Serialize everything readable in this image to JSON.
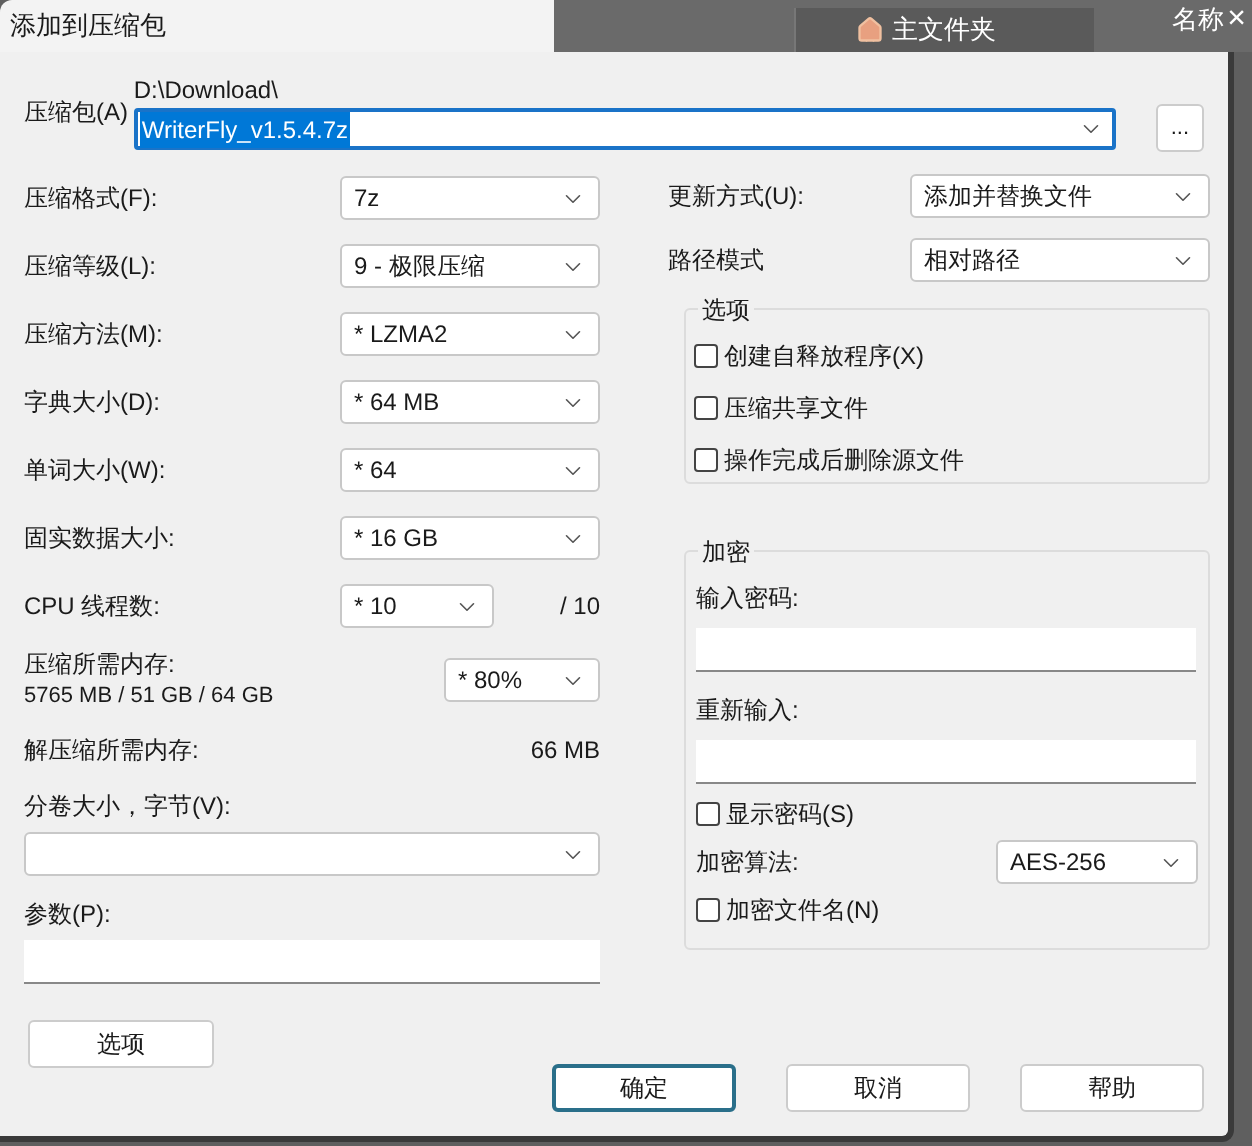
{
  "window": {
    "title": "添加到压缩包",
    "close": "×"
  },
  "background": {
    "home_tab": "主文件夹",
    "column_header": "名称"
  },
  "archive": {
    "label": "压缩包(A)",
    "folder": "D:\\Download\\",
    "value": "WriterFly_v1.5.4.7z",
    "browse_button": "..."
  },
  "settings": [
    {
      "kind": "select",
      "label": "压缩格式(F):",
      "value": "7z"
    },
    {
      "kind": "select",
      "label": "压缩等级(L):",
      "value": "9 - 极限压缩"
    },
    {
      "kind": "select",
      "label": "压缩方法(M):",
      "value": "* LZMA2"
    },
    {
      "kind": "select",
      "label": "字典大小(D):",
      "value": "* 64 MB"
    },
    {
      "kind": "select",
      "label": "单词大小(W):",
      "value": "* 64"
    },
    {
      "kind": "select",
      "label": "固实数据大小:",
      "value": "* 16 GB"
    },
    {
      "kind": "threads",
      "label": "CPU 线程数:",
      "value": "* 10",
      "total": "/ 10"
    },
    {
      "kind": "memory",
      "label": "压缩所需内存:",
      "detail": "5765 MB / 51 GB / 64 GB",
      "value": "* 80%"
    },
    {
      "kind": "readout",
      "label": "解压缩所需内存:",
      "value": "66 MB"
    }
  ],
  "split": {
    "label": "分卷大小，字节(V):"
  },
  "parameters": {
    "label": "参数(P):"
  },
  "options_button": "选项",
  "update_mode": {
    "label": "更新方式(U):",
    "value": "添加并替换文件"
  },
  "path_mode": {
    "label": "路径模式",
    "value": "相对路径"
  },
  "options_group": {
    "title": "选项",
    "items": [
      {
        "label": "创建自释放程序(X)",
        "checked": false
      },
      {
        "label": "压缩共享文件",
        "checked": false
      },
      {
        "label": "操作完成后删除源文件",
        "checked": false
      }
    ]
  },
  "encryption": {
    "title": "加密",
    "password_label": "输入密码:",
    "reenter_label": "重新输入:",
    "show_password": {
      "label": "显示密码(S)",
      "checked": false
    },
    "method_label": "加密算法:",
    "method": "AES-256",
    "encrypt_names": {
      "label": "加密文件名(N)",
      "checked": false
    }
  },
  "buttons": [
    {
      "label": "确定",
      "selected": true
    },
    {
      "label": "取消",
      "selected": false
    },
    {
      "label": "帮助",
      "selected": false
    }
  ]
}
